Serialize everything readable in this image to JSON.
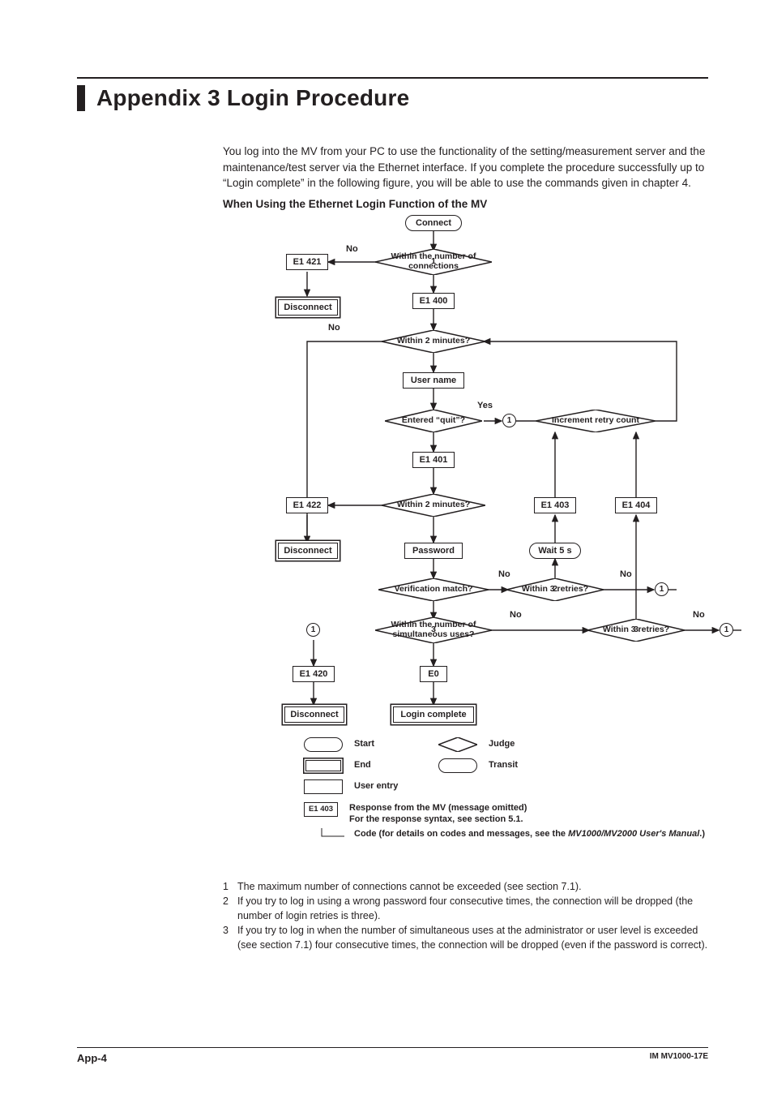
{
  "title": "Appendix 3   Login Procedure",
  "intro": "You log into the MV from your PC to use the functionality of the setting/measurement server and the maintenance/test server via the Ethernet interface. If you complete the procedure successfully up to “Login complete” in the following figure, you will be able to use the commands given in chapter 4.",
  "subhead": "When Using the Ethernet Login Function of the MV",
  "flow": {
    "connect": "Connect",
    "withinConn": "Within the number of connections",
    "e1_421": "E1 421",
    "e1_400": "E1 400",
    "disconnect": "Disconnect",
    "within2a": "Within 2 minutes?",
    "userName": "User name",
    "enteredQuit": "Entered “quit”?",
    "incrementRetry": "Increment retry count",
    "e1_401": "E1 401",
    "e1_422": "E1 422",
    "within2b": "Within 2 minutes?",
    "e1_403": "E1 403",
    "e1_404": "E1 404",
    "password": "Password",
    "wait5s": "Wait 5 s",
    "verifMatch": "Verification match?",
    "within3a": "Within 3 retries?",
    "withinSimul": "Within the number of simultaneous uses?",
    "within3b": "Within 3 retries?",
    "e1_420": "E1 420",
    "e0": "E0",
    "loginComplete": "Login complete",
    "no": "No",
    "yes": "Yes",
    "sup1": "1",
    "sup2": "2",
    "sup3": "3",
    "one": "1"
  },
  "legend": {
    "start": "Start",
    "end": "End",
    "userEntry": "User entry",
    "judge": "Judge",
    "transit": "Transit",
    "respBox": "E1 403",
    "resp1": "Response from the MV (message omitted)",
    "resp2": "For the response syntax, see section 5.1.",
    "code": "Code (for details on codes and messages, see the ",
    "codeItal": "MV1000/MV2000 User's Manual",
    "codeEnd": ".)"
  },
  "footnotes": [
    "The maximum number of connections cannot be exceeded (see section 7.1).",
    "If you try to log in using a wrong password four consecutive times, the connection will be dropped (the number of login retries is three).",
    "If you try to log in when the number of simultaneous uses at the administrator or user level is exceeded (see section 7.1) four consecutive times, the connection will be dropped (even if the password is correct)."
  ],
  "footer": {
    "page": "App-4",
    "doc": "IM MV1000-17E"
  }
}
